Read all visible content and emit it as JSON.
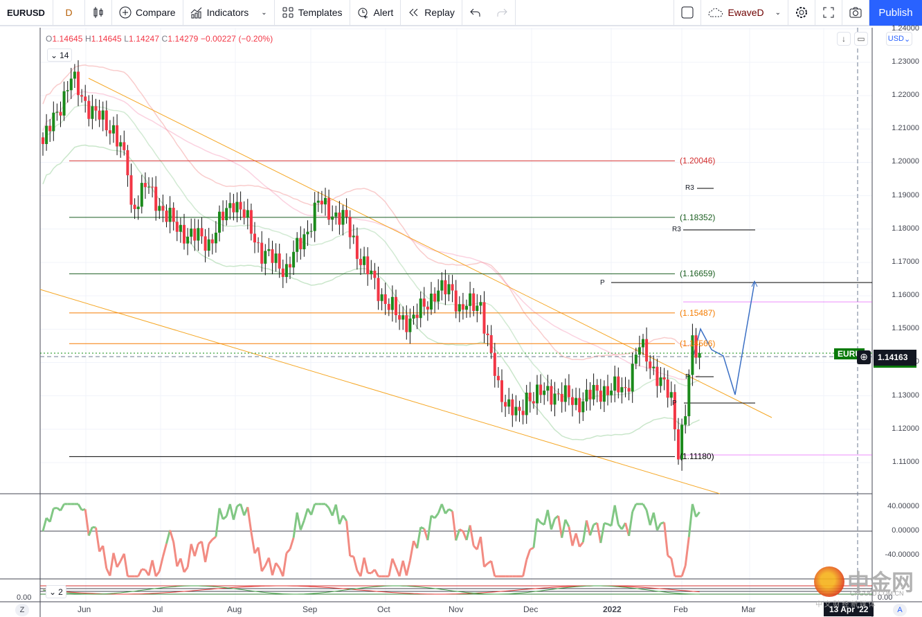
{
  "toolbar": {
    "symbol": "EURUSD",
    "interval": "D",
    "compare": "Compare",
    "indicators": "Indicators",
    "templates": "Templates",
    "alert": "Alert",
    "replay": "Replay",
    "layout_name": "EwaveD",
    "publish": "Publish"
  },
  "legend": {
    "o_label": "O",
    "o": "1.14645",
    "h_label": "H",
    "h": "1.14645",
    "l_label": "L",
    "l": "1.14247",
    "c_label": "C",
    "c": "1.14279",
    "change": "−0.00227 (−0.20%)",
    "indicator_count": "14"
  },
  "price_axis": {
    "currency": "USD",
    "ticks": [
      "1.24000",
      "1.23000",
      "1.22000",
      "1.21000",
      "1.20000",
      "1.19000",
      "1.18000",
      "1.17000",
      "1.16000",
      "1.15000",
      "1.14000",
      "1.13000",
      "1.12000",
      "1.11000"
    ],
    "symbol_tag": "EURU",
    "current_price": "1.14163"
  },
  "osc_axis": {
    "ticks": [
      "40.00000",
      "0.00000",
      "-40.00000"
    ],
    "lower_label": "0.00",
    "lower_right": "0.00",
    "lower_count": "2"
  },
  "time_axis": {
    "labels": [
      "Jun",
      "Jul",
      "Aug",
      "Sep",
      "Oct",
      "Nov",
      "Dec",
      "2022",
      "Feb",
      "Mar"
    ],
    "cursor_date": "13 Apr '22",
    "left_btn": "Z",
    "right_btn": "A"
  },
  "levels": [
    {
      "label": "(1.20046)",
      "price": 1.20046,
      "color": "#d32f2f"
    },
    {
      "label": "(1.18352)",
      "price": 1.18352,
      "color": "#1b5e20"
    },
    {
      "label": "(1.16659)",
      "price": 1.16659,
      "color": "#1b5e20"
    },
    {
      "label": "(1.15487)",
      "price": 1.15487,
      "color": "#f57c00"
    },
    {
      "label": "(1.14566)",
      "price": 1.14566,
      "color": "#f57c00"
    },
    {
      "label": "(1.11180)",
      "price": 1.1118,
      "color": "#000000"
    }
  ],
  "pivots": {
    "r3a": "R3",
    "r3b": "R3",
    "p1": "P",
    "p2": "P",
    "p3": "P"
  },
  "watermark": {
    "brand": "中金网",
    "domain": "CNGOLD.COM.CN",
    "tagline": "中 文 财 经 新 媒 体"
  },
  "colors": {
    "up": "#089981",
    "up_candle": "#1b8a1b",
    "down": "#f23645",
    "accent": "#2962ff",
    "forecast": "#3a6fc4"
  },
  "price_anchors": [
    [
      0,
      1.2055
    ],
    [
      8,
      1.225
    ],
    [
      14,
      1.215
    ],
    [
      20,
      1.21
    ],
    [
      24,
      1.198
    ],
    [
      25,
      1.186
    ],
    [
      29,
      1.193
    ],
    [
      38,
      1.18
    ],
    [
      47,
      1.176
    ],
    [
      54,
      1.189
    ],
    [
      57,
      1.184
    ],
    [
      62,
      1.173
    ],
    [
      69,
      1.168
    ],
    [
      75,
      1.18
    ],
    [
      78,
      1.188
    ],
    [
      86,
      1.182
    ],
    [
      90,
      1.171
    ],
    [
      96,
      1.16
    ],
    [
      101,
      1.153
    ],
    [
      105,
      1.153
    ],
    [
      111,
      1.161
    ],
    [
      116,
      1.162
    ],
    [
      118,
      1.156
    ],
    [
      124,
      1.158
    ],
    [
      126,
      1.146
    ],
    [
      129,
      1.132
    ],
    [
      135,
      1.123
    ],
    [
      137,
      1.13
    ],
    [
      145,
      1.131
    ],
    [
      151,
      1.128
    ],
    [
      159,
      1.132
    ],
    [
      165,
      1.132
    ],
    [
      169,
      1.145
    ],
    [
      172,
      1.14
    ],
    [
      175,
      1.134
    ],
    [
      178,
      1.129
    ],
    [
      180,
      1.114
    ],
    [
      182,
      1.125
    ],
    [
      184,
      1.145
    ],
    [
      186,
      1.1428
    ]
  ]
}
